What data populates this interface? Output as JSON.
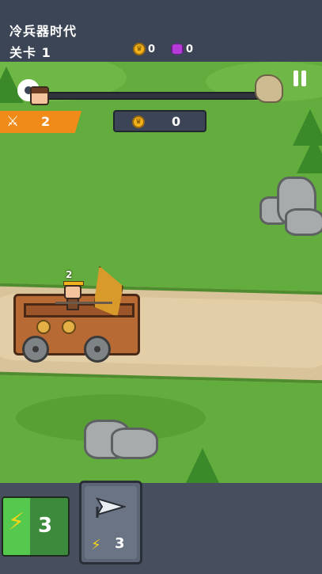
{
  "header": {
    "title": "冷兵器时代",
    "level": "关卡 1",
    "coins": "0",
    "gems": "0"
  },
  "hud": {
    "kills": "2",
    "battle_coins": "0",
    "unit_level": "2"
  },
  "cards": {
    "energy": "3",
    "spearman_cost": "3"
  },
  "colors": {
    "topbar": "#3b4555",
    "grass": "#62ad3d",
    "road": "#e2cfa7",
    "kill_banner": "#f08b1a",
    "coin": "#f2b21b",
    "gem": "#b43bd8",
    "energy_card": "#55c94e"
  },
  "icons": [
    "settings-gear-icon",
    "pause-icon",
    "hero-portrait-icon",
    "goal-rock-icon",
    "crossed-swords-icon",
    "crown-coin-icon",
    "gem-icon",
    "lightning-bolt-icon",
    "spearhead-icon"
  ]
}
